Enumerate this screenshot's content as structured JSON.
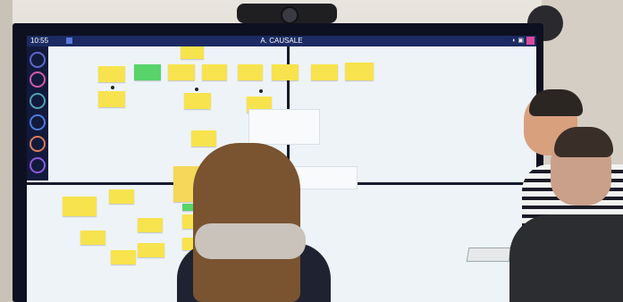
{
  "screen": {
    "clock": "10:55",
    "board_title": "A. CAUSALE",
    "topbar_icons": "◐ ▣"
  },
  "colors": {
    "topbar": "#1b2a63",
    "sticky_yellow": "#f7e34d",
    "sticky_green": "#58d46a",
    "close_button": "#d94a9a"
  },
  "icons": [
    "camera-icon",
    "close-icon",
    "sidebar-tool-icon"
  ]
}
